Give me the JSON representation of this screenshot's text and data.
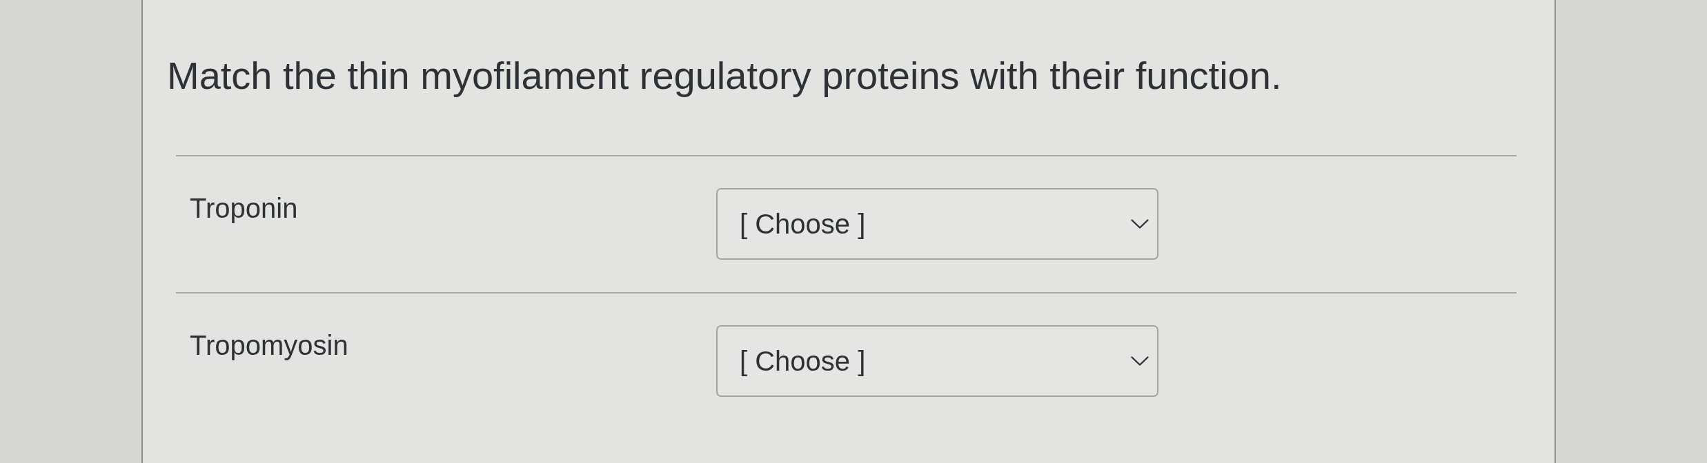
{
  "question": {
    "prompt": "Match the thin myofilament regulatory proteins with their function."
  },
  "matches": [
    {
      "term": "Troponin",
      "answer": {
        "placeholder": "[ Choose ]"
      }
    },
    {
      "term": "Tropomyosin",
      "answer": {
        "placeholder": "[ Choose ]"
      }
    }
  ]
}
